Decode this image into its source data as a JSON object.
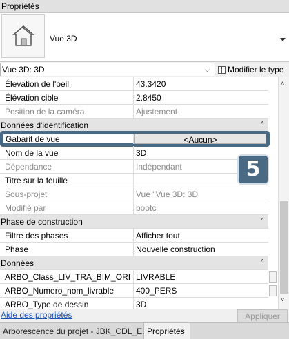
{
  "panel": {
    "title": "Propriétés"
  },
  "type_selector": {
    "name": "Vue 3D",
    "icon": "house-3d-icon"
  },
  "instance_selector": {
    "value": "Vue 3D: 3D",
    "edit_type_label": "Modifier le type"
  },
  "rows": [
    {
      "label": "Élevation de l'oeil",
      "value": "43.3420"
    },
    {
      "label": "Élévation cible",
      "value": "2.8450"
    },
    {
      "label": "Position de la caméra",
      "value": "Ajustement"
    },
    {
      "label": "Données d'identification",
      "value": ""
    },
    {
      "label": "Gabarit de vue",
      "value": "<Aucun>"
    },
    {
      "label": "Nom de la vue",
      "value": "3D"
    },
    {
      "label": "Dépendance",
      "value": "Indépendant"
    },
    {
      "label": "Titre sur la feuille",
      "value": ""
    },
    {
      "label": "Sous-projet",
      "value": "Vue \"Vue 3D: 3D"
    },
    {
      "label": "Modifié par",
      "value": "bootc"
    },
    {
      "label": "Phase de construction",
      "value": ""
    },
    {
      "label": "Filtre des phases",
      "value": "Afficher tout"
    },
    {
      "label": "Phase",
      "value": "Nouvelle construction"
    },
    {
      "label": "Données",
      "value": ""
    },
    {
      "label": "ARBO_Class_LIV_TRA_BIM_ORI",
      "value": "LIVRABLE"
    },
    {
      "label": "ARBO_Numero_nom_livrable",
      "value": "400_PERS"
    },
    {
      "label": "ARBO_Type de dessin",
      "value": "3D"
    }
  ],
  "badge": {
    "number": "5"
  },
  "footer": {
    "help_link": "Aide des propriétés",
    "apply_label": "Appliquer"
  },
  "tabs": [
    {
      "label": "Arborescence du projet - JBK_CDL_E...",
      "active": false
    },
    {
      "label": "Propriétés",
      "active": true
    }
  ],
  "colors": {
    "highlight": "#4a6a84",
    "link": "#1a54b4",
    "group_bg": "#e4e4e4"
  }
}
